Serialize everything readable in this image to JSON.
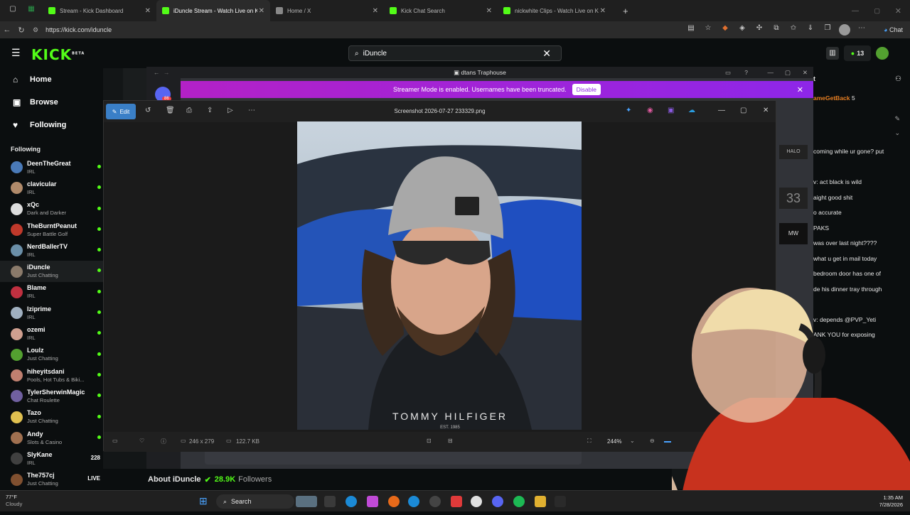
{
  "browser": {
    "tabs": [
      {
        "label": "Stream - Kick Dashboard",
        "fav": "#53fc18",
        "active": false
      },
      {
        "label": "iDuncle Stream - Watch Live on Kick",
        "fav": "#53fc18",
        "active": true
      },
      {
        "label": "Home / X",
        "fav": "#888888",
        "active": false
      },
      {
        "label": "Kick Chat Search",
        "fav": "#53fc18",
        "active": false
      },
      {
        "label": "nickwhite Clips - Watch Live on Kick",
        "fav": "#53fc18",
        "active": false
      }
    ],
    "url": "https://kick.com/iduncle",
    "chat_label": "Chat"
  },
  "kick": {
    "logo": "KICK",
    "logo_badge": "BETA",
    "search_value": "iDuncle",
    "notif_count": "13",
    "nav": [
      {
        "label": "Home",
        "icon": "home-icon",
        "glyph": "⌂"
      },
      {
        "label": "Browse",
        "icon": "browse-icon",
        "glyph": "▣"
      },
      {
        "label": "Following",
        "icon": "heart-icon",
        "glyph": "♥"
      }
    ],
    "following_header": "Following",
    "channels": [
      {
        "name": "DeenTheGreat",
        "category": "IRL",
        "color": "#4a7ab8",
        "status": "dot"
      },
      {
        "name": "clavicular",
        "category": "IRL",
        "color": "#b08a6a",
        "status": "dot"
      },
      {
        "name": "xQc",
        "category": "Dark and Darker",
        "color": "#dddddd",
        "status": "dot"
      },
      {
        "name": "TheBurntPeanut",
        "category": "Super Battle Golf",
        "color": "#c0392b",
        "status": "dot"
      },
      {
        "name": "NerdBallerTV",
        "category": "IRL",
        "color": "#6b8fa8",
        "status": "dot"
      },
      {
        "name": "iDuncle",
        "category": "Just Chatting",
        "color": "#8a7a6a",
        "status": "dot",
        "selected": true
      },
      {
        "name": "Blame",
        "category": "IRL",
        "color": "#c03040",
        "status": "dot"
      },
      {
        "name": "Iziprime",
        "category": "IRL",
        "color": "#a0b0c0",
        "status": "dot"
      },
      {
        "name": "ozemi",
        "category": "IRL",
        "color": "#d0a090",
        "status": "dot"
      },
      {
        "name": "Loulz",
        "category": "Just Chatting",
        "color": "#53a030",
        "status": "dot"
      },
      {
        "name": "hiheyitsdani",
        "category": "Pools, Hot Tubs & Biki...",
        "color": "#c08070",
        "status": "dot"
      },
      {
        "name": "TylerSherwinMagic",
        "category": "Chat Roulette",
        "color": "#7060a0",
        "status": "dot"
      },
      {
        "name": "Tazo",
        "category": "Just Chatting",
        "color": "#e0c050",
        "status": "dot"
      },
      {
        "name": "Andy",
        "category": "Slots & Casino",
        "color": "#a07050",
        "status": "dot"
      },
      {
        "name": "SlyKane",
        "category": "IRL",
        "color": "#404040",
        "status": "228"
      },
      {
        "name": "The757cj",
        "category": "Just Chatting",
        "color": "#805030",
        "status": "LIVE"
      }
    ],
    "about_label": "About iDuncle",
    "followers_count": "28.9K",
    "followers_label": "Followers"
  },
  "chat": {
    "first_user": "ameGetBack",
    "first_count": "5",
    "lines": [
      "coming while ur gone? put",
      "",
      "v: act black is wild",
      "aight good shit",
      "o accurate",
      "PAKS",
      "was over last night????",
      "what u get in mail today",
      "bedroom door has one of",
      "de his dinner tray through",
      "",
      "v: depends @PVP_Yeti",
      "ANK YOU for exposing"
    ],
    "chat_button": "hat"
  },
  "discord": {
    "title": "dtans Traphouse",
    "banner_text": "Streamer Mode is enabled. Usernames have been truncated.",
    "disable_label": "Disable",
    "badge": "86"
  },
  "viewer": {
    "edit_label": "Edit",
    "filename": "Screenshot 2026-07-27 233329.png",
    "dimensions": "246 x 279",
    "filesize": "122.7 KB",
    "zoom": "244%"
  },
  "photo": {
    "shirt_text": "TOMMY HILFIGER",
    "shirt_sub": "EST. 1985"
  },
  "taskbar": {
    "weather_temp": "77°F",
    "weather_desc": "Cloudy",
    "search_label": "Search",
    "time": "1:35 AM",
    "date": "7/28/2026"
  }
}
